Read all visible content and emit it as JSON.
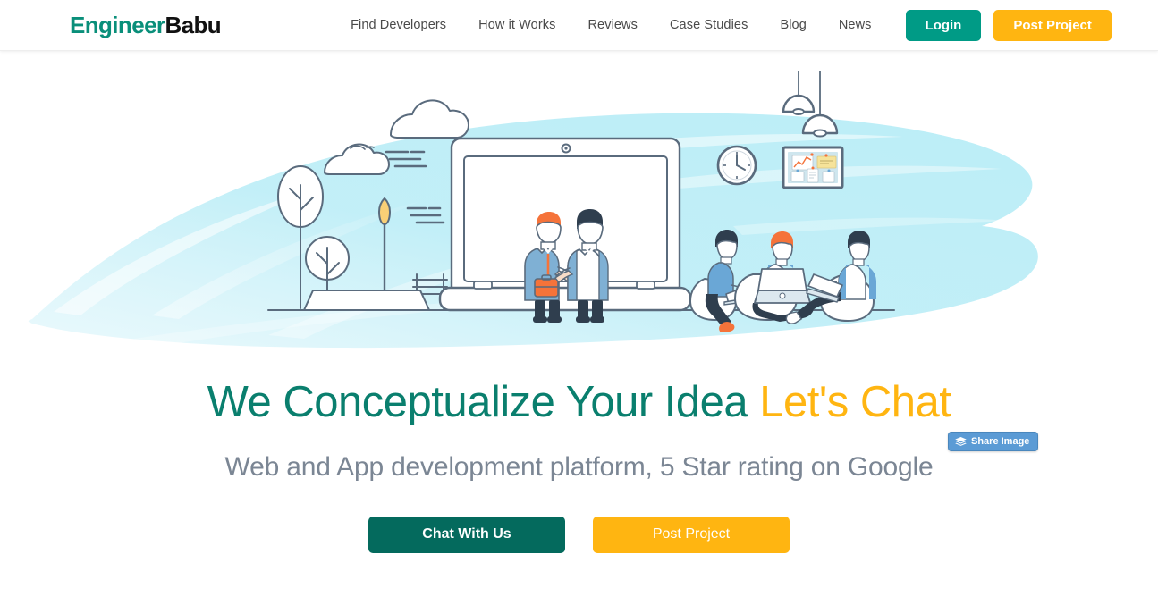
{
  "header": {
    "logo": {
      "part1": "Engineer",
      "part2": "Babu",
      "color1": "#0a8f7a",
      "color2": "#111111"
    },
    "nav": [
      {
        "label": "Find Developers"
      },
      {
        "label": "How it Works"
      },
      {
        "label": "Reviews"
      },
      {
        "label": "Case Studies"
      },
      {
        "label": "Blog"
      },
      {
        "label": "News"
      }
    ],
    "login_label": "Login",
    "post_project_label": "Post Project",
    "login_color": "#009b86",
    "post_project_color": "#ffb511"
  },
  "hero": {
    "headline_main": "We Conceptualize Your Idea ",
    "headline_accent": "Let's Chat",
    "headline_color": "#0a7f6e",
    "headline_accent_color": "#ffb511",
    "subheadline": "Web and App development platform, 5 Star rating on Google",
    "subheadline_color": "#7b8694",
    "cta_chat_label": "Chat With Us",
    "cta_post_label": "Post Project",
    "cta_chat_color": "#046a5d",
    "cta_post_color": "#ffb511"
  },
  "share_badge": {
    "label": "Share Image",
    "icon": "layers-icon",
    "background": "#5b9bd5"
  },
  "illustration": {
    "alt": "Two businessmen shaking hands in front of a large laptop, with three developers sitting on bean bags using laptops, trees, street lamp, bench, clouds, wall clock, pinboard and hanging pendant lamps on a light blue watercolor background",
    "splash_color": "#bff0f7",
    "line_color": "#5a6b7d",
    "accent_orange": "#f5733a",
    "accent_blue": "#6aa7d6",
    "lamp_yellow": "#f9cf76"
  }
}
